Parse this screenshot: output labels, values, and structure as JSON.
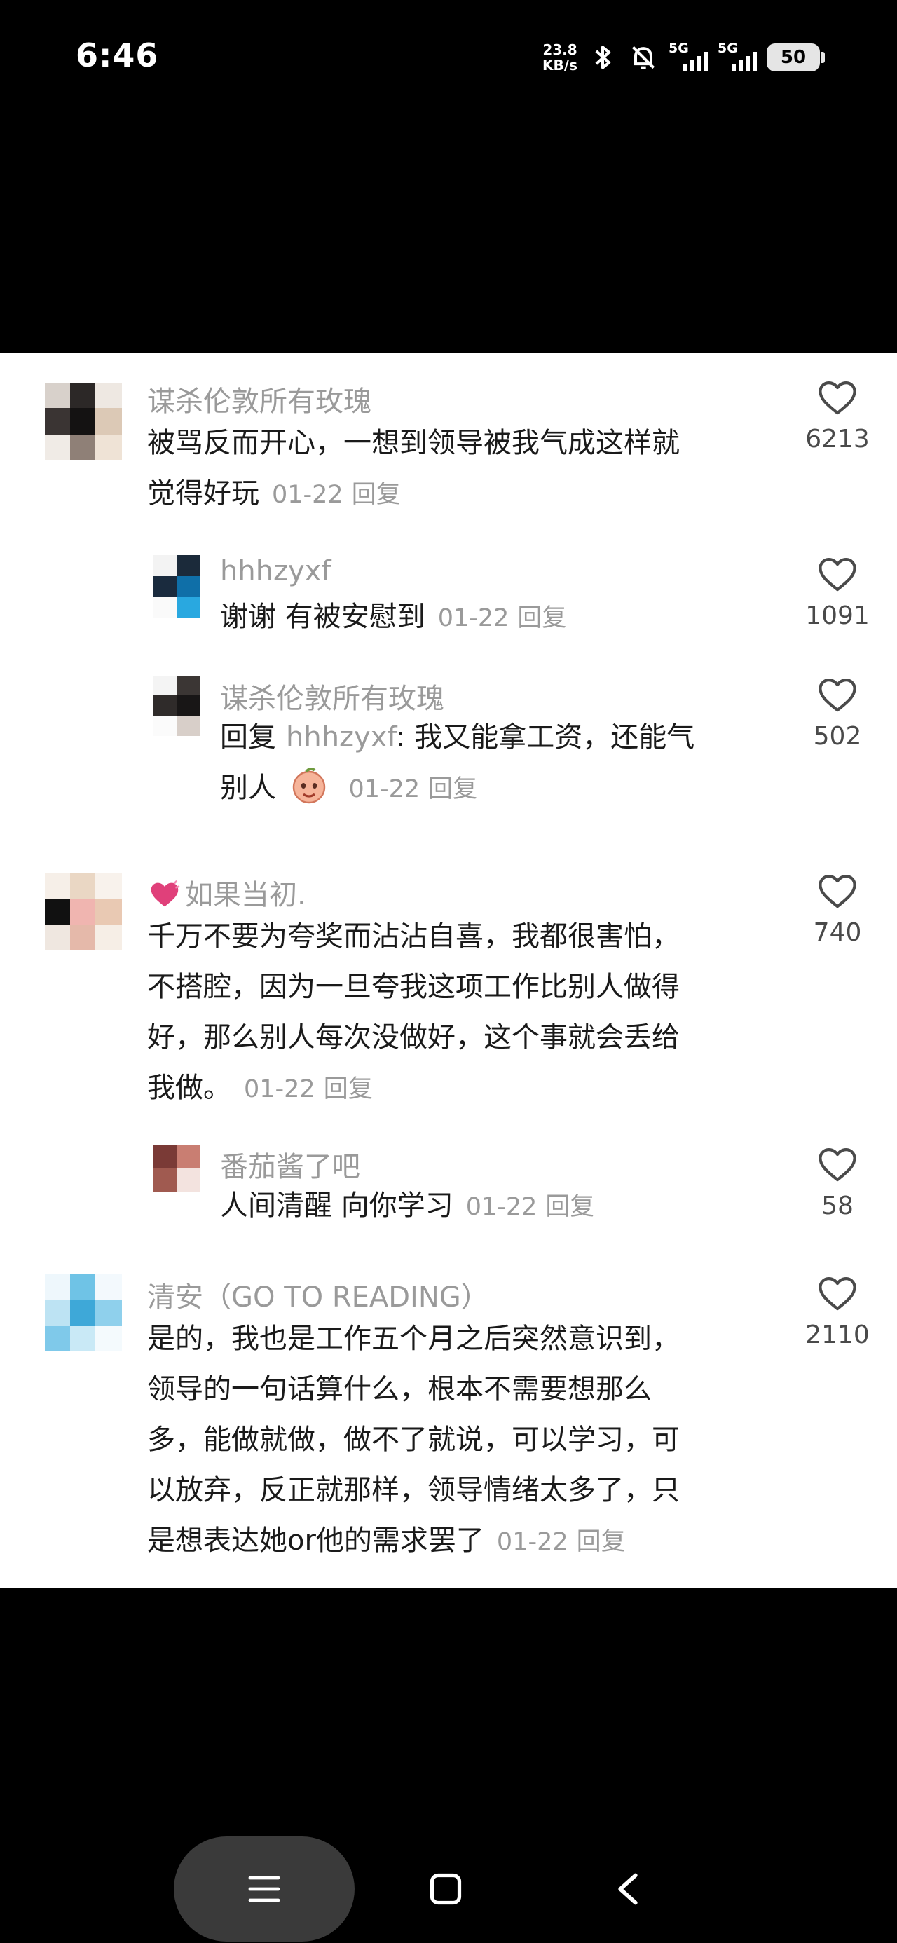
{
  "status_bar": {
    "time": "6:46",
    "net_speed_value": "23.8",
    "net_speed_unit": "KB/s",
    "sim1_label": "5G",
    "sim2_label": "5G",
    "battery": "50"
  },
  "comments": [
    {
      "username": "谋杀伦敦所有玫瑰",
      "lines": [
        "被骂反而开心，一想到领导被我气成这样就",
        "觉得好玩"
      ],
      "date": "01-22",
      "reply_label": "回复",
      "likes": "6213"
    },
    {
      "username": "hhhzyxf",
      "lines": [
        "谢谢 有被安慰到"
      ],
      "date": "01-22",
      "reply_label": "回复",
      "likes": "1091"
    },
    {
      "username": "谋杀伦敦所有玫瑰",
      "reply_prefix": "回复",
      "reply_target": "hhhzyxf",
      "lines": [
        ": 我又能拿工资，还能气",
        "别人"
      ],
      "emoji": "peach-emoji",
      "date": "01-22",
      "reply_label": "回复",
      "likes": "502"
    },
    {
      "username": "如果当初.",
      "name_icon": "heart-emoji",
      "lines": [
        "千万不要为夸奖而沾沾自喜，我都很害怕，",
        "不搭腔，因为一旦夸我这项工作比别人做得",
        "好，那么别人每次没做好，这个事就会丢给",
        "我做。"
      ],
      "date": "01-22",
      "reply_label": "回复",
      "likes": "740"
    },
    {
      "username": "番茄酱了吧",
      "lines": [
        "人间清醒 向你学习"
      ],
      "date": "01-22",
      "reply_label": "回复",
      "likes": "58"
    },
    {
      "username": "清安（GO TO READING）",
      "lines": [
        "是的，我也是工作五个月之后突然意识到，",
        "领导的一句话算什么，根本不需要想那么",
        "多，能做就做，做不了就说，可以学习，可",
        "以放弃，反正就那样，领导情绪太多了，只",
        "是想表达她or他的需求罢了"
      ],
      "date": "01-22",
      "reply_label": "回复",
      "likes": "2110"
    }
  ],
  "nav": {
    "menu_icon": "menu-icon",
    "home_icon": "square-home-icon",
    "back_icon": "back-chevron-icon"
  },
  "colors": {
    "username_gray": "#9a9a9a",
    "text_black": "#1a1a1a",
    "like_count": "#4a4a4a",
    "heart_emoji": "#e0407a"
  }
}
